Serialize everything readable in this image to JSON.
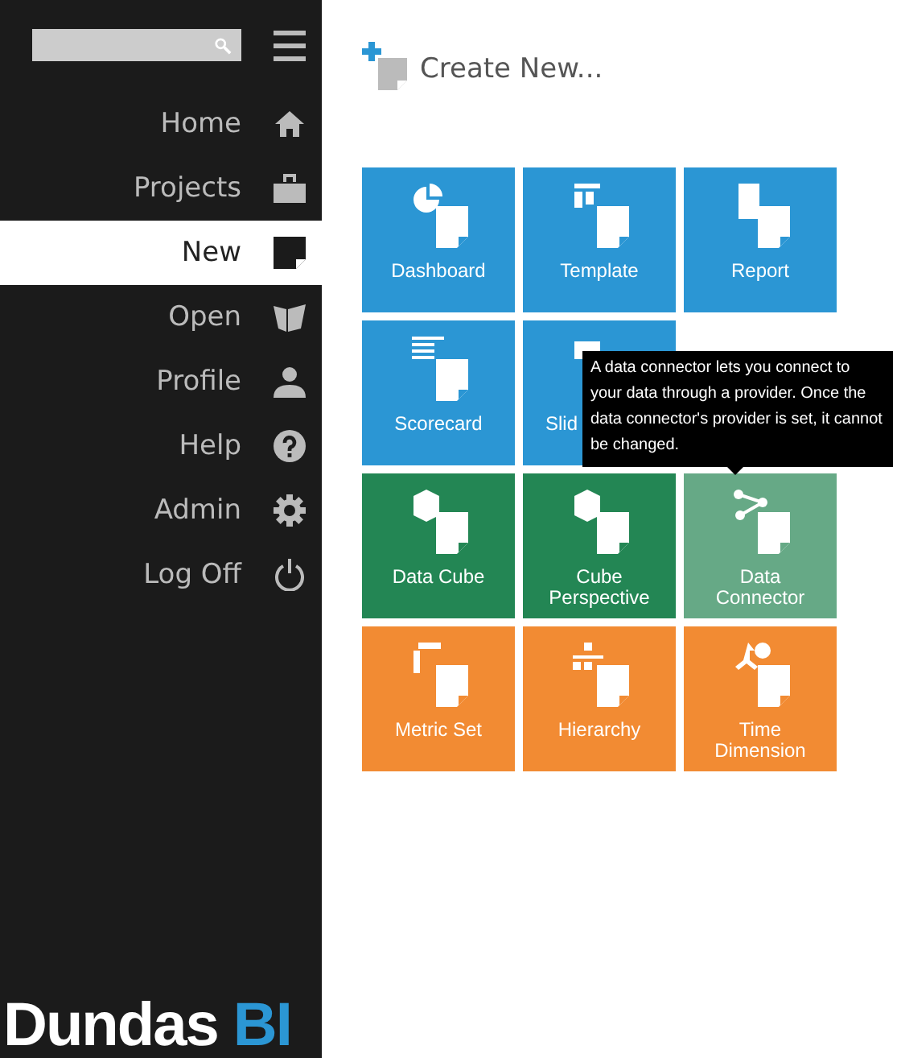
{
  "sidebar": {
    "items": [
      {
        "label": "Home",
        "kind": "home",
        "selected": false
      },
      {
        "label": "Projects",
        "kind": "projects",
        "selected": false
      },
      {
        "label": "New",
        "kind": "new",
        "selected": true
      },
      {
        "label": "Open",
        "kind": "open",
        "selected": false
      },
      {
        "label": "Profile",
        "kind": "profile",
        "selected": false
      },
      {
        "label": "Help",
        "kind": "help",
        "selected": false
      },
      {
        "label": "Admin",
        "kind": "admin",
        "selected": false
      },
      {
        "label": "Log Off",
        "kind": "logoff",
        "selected": false
      }
    ],
    "logo": {
      "text": "Dundas",
      "accent": "BI"
    }
  },
  "heading": "Create New...",
  "tile_rows": [
    [
      {
        "label": "Dashboard",
        "kind": "dashboard",
        "color": "#2b96d4",
        "covered": false
      },
      {
        "label": "Template",
        "kind": "template",
        "color": "#2b96d4",
        "covered": false
      },
      {
        "label": "Report",
        "kind": "report",
        "color": "#2b96d4",
        "covered": false
      }
    ],
    [
      {
        "label": "Scorecard",
        "kind": "scorecard",
        "color": "#2b96d4",
        "covered": false
      },
      {
        "label": "Slid",
        "kind": "slide",
        "color": "#2b96d4",
        "covered": true
      }
    ],
    [
      {
        "label": "Data Cube",
        "kind": "cube",
        "color": "#238654",
        "covered": false
      },
      {
        "label": "Cube Perspective",
        "kind": "perspective",
        "color": "#238654",
        "covered": false
      },
      {
        "label": "Data Connector",
        "kind": "connector",
        "color": "#66a986",
        "covered": false
      }
    ],
    [
      {
        "label": "Metric Set",
        "kind": "metric",
        "color": "#f28b33",
        "covered": false
      },
      {
        "label": "Hierarchy",
        "kind": "hierarchy",
        "color": "#f28b33",
        "covered": false
      },
      {
        "label": "Time Dimension",
        "kind": "time",
        "color": "#f28b33",
        "covered": false
      }
    ]
  ],
  "tooltip": "A data connector lets you connect to your data through a provider. Once the data connector's provider is set, it cannot be changed."
}
